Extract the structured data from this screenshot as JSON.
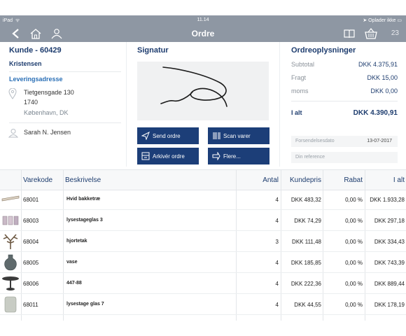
{
  "status_bar": {
    "device": "iPad",
    "time": "11.14",
    "charging": "Oplader ikke"
  },
  "nav": {
    "title": "Ordre",
    "cart_count": "23"
  },
  "customer": {
    "heading": "Kunde - 60429",
    "name": "Kristensen",
    "delivery_label": "Leveringsadresse",
    "street": "Tietgensgade 130",
    "zip": "1740",
    "city": "København, DK",
    "contact": "Sarah N. Jensen"
  },
  "signature": {
    "heading": "Signatur",
    "buttons": {
      "send": "Send ordre",
      "scan": "Scan varer",
      "archive": "Arkivér ordre",
      "more": "Flere..."
    }
  },
  "order_info": {
    "heading": "Ordreoplysninger",
    "subtotal_label": "Subtotal",
    "subtotal": "DKK 4.375,91",
    "freight_label": "Fragt",
    "freight": "DKK 15,00",
    "vat_label": "moms",
    "vat": "DKK 0,00",
    "total_label": "I alt",
    "total": "DKK 4.390,91",
    "ship_date_label": "Forsendelsesdato",
    "ship_date": "13-07-2017",
    "reference_placeholder": "Din reference"
  },
  "table": {
    "headers": {
      "code": "Varekode",
      "desc": "Beskrivelse",
      "qty": "Antal",
      "price": "Kundepris",
      "discount": "Rabat",
      "total": "I alt"
    },
    "rows": [
      {
        "code": "68001",
        "desc": "Hvid bakketræ",
        "qty": "4",
        "price": "DKK 483,32",
        "discount": "0,00 %",
        "total": "DKK 1.933,28",
        "thumb": "tray"
      },
      {
        "code": "68003",
        "desc": "lysestageglas 3",
        "qty": "4",
        "price": "DKK 74,29",
        "discount": "0,00 %",
        "total": "DKK 297,18",
        "thumb": "glasses"
      },
      {
        "code": "68004",
        "desc": "hjortetak",
        "qty": "3",
        "price": "DKK 111,48",
        "discount": "0,00 %",
        "total": "DKK 334,43",
        "thumb": "antlers"
      },
      {
        "code": "68005",
        "desc": "vase",
        "qty": "4",
        "price": "DKK 185,85",
        "discount": "0,00 %",
        "total": "DKK 743,39",
        "thumb": "vase"
      },
      {
        "code": "68006",
        "desc": "447-88",
        "qty": "4",
        "price": "DKK 222,36",
        "discount": "0,00 %",
        "total": "DKK 889,44",
        "thumb": "stand"
      },
      {
        "code": "68011",
        "desc": "lysestage glas 7",
        "qty": "4",
        "price": "DKK 44,55",
        "discount": "0,00 %",
        "total": "DKK 178,19",
        "thumb": "glass"
      }
    ]
  },
  "colors": {
    "navbar": "#8e97a3",
    "accent": "#1c3e78",
    "link": "#2a6fb6"
  }
}
